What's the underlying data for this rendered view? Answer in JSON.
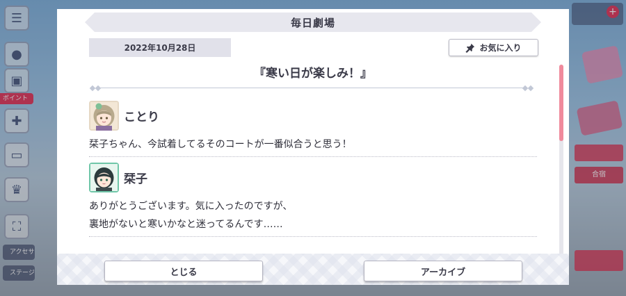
{
  "dialog": {
    "header_title": "毎日劇場",
    "date": "2022年10月28日",
    "favorite_label": "お気に入り",
    "story_title": "『寒い日が楽しみ！』",
    "entries": [
      {
        "speaker": "ことり",
        "text": "栞子ちゃん、今試着してるそのコートが一番似合うと思う！"
      },
      {
        "speaker": "栞子",
        "text": "ありがとうございます。気に入ったのですが、\n裏地がないと寒いかなと迷ってるんです……"
      }
    ],
    "close_label": "とじる",
    "archive_label": "アーカイブ"
  },
  "background": {
    "left_tag": "ボイント",
    "left_labels": [
      "アクセサリー",
      "ステージ\nアイテム"
    ],
    "right_label_1": "合宿"
  },
  "colors": {
    "accent": "#f08a9c",
    "text": "#3a3a48",
    "header_band": "#e7e7ee"
  },
  "icons": {
    "favorite": "pin-icon",
    "avatar_1": "kotori-avatar",
    "avatar_2": "shioriko-avatar"
  }
}
